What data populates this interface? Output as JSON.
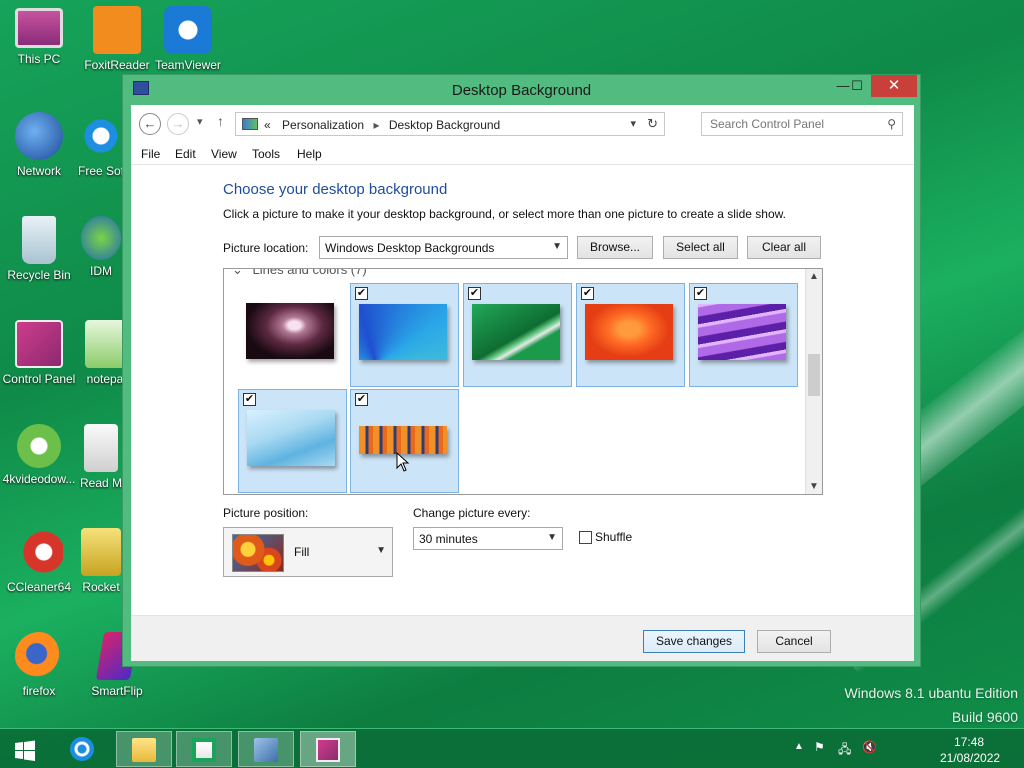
{
  "desktop": {
    "icons": [
      {
        "label": "This PC"
      },
      {
        "label": "FoxitReader"
      },
      {
        "label": "TeamViewer"
      },
      {
        "label": "Network"
      },
      {
        "label": "Free Sof"
      },
      {
        "label": "Recycle Bin"
      },
      {
        "label": "IDM"
      },
      {
        "label": "Control Panel"
      },
      {
        "label": "notepa"
      },
      {
        "label": "4kvideodow..."
      },
      {
        "label": "Read M"
      },
      {
        "label": "CCleaner64"
      },
      {
        "label": "Rocket"
      },
      {
        "label": "firefox"
      },
      {
        "label": "SmartFlip"
      }
    ],
    "watermark_line1": "Windows 8.1 ubantu Edition",
    "watermark_line2": "Build 9600"
  },
  "window": {
    "title": "Desktop Background",
    "controls": {
      "minimize": "—",
      "maximize": "☐",
      "close": "✕"
    },
    "address": {
      "breadcrumb_prefix": "«",
      "crumbs": [
        "Personalization",
        "Desktop Background"
      ],
      "separator": "▸"
    },
    "search": {
      "placeholder": "Search Control Panel"
    },
    "menu": [
      "File",
      "Edit",
      "View",
      "Tools",
      "Help"
    ],
    "heading": "Choose your desktop background",
    "subtext": "Click a picture to make it your desktop background, or select more than one picture to create a slide show.",
    "picture_location": {
      "label": "Picture location:",
      "value": "Windows Desktop Backgrounds",
      "browse": "Browse...",
      "select_all": "Select all",
      "clear_all": "Clear all"
    },
    "gallery": {
      "group_header": "Lines and colors (7)",
      "tiles": [
        {
          "name": "purple-nebula",
          "checked": false,
          "colors": [
            "#f0d7e6",
            "#6b2b46",
            "#1b0d14"
          ]
        },
        {
          "name": "blue-petals",
          "checked": true,
          "colors": [
            "#2aa8e8",
            "#1f4fd0",
            "#58d6c9"
          ]
        },
        {
          "name": "green-lines",
          "checked": true,
          "colors": [
            "#1a9a4a",
            "#0e6d32",
            "#6fd08a"
          ]
        },
        {
          "name": "orange-swirl",
          "checked": true,
          "colors": [
            "#ff7a2a",
            "#e53e14",
            "#ff9b3d"
          ]
        },
        {
          "name": "purple-waves",
          "checked": true,
          "colors": [
            "#b06ae8",
            "#5b1fa8",
            "#e2b6ff"
          ]
        },
        {
          "name": "light-blue-curve",
          "checked": true,
          "colors": [
            "#a9d9f2",
            "#5fb3e0",
            "#d9f1ff"
          ]
        },
        {
          "name": "orange-city",
          "checked": true,
          "colors": [
            "#2c3e7a",
            "#f09028",
            "#e86a1a"
          ]
        }
      ]
    },
    "picture_position": {
      "label": "Picture position:",
      "value": "Fill"
    },
    "change_picture": {
      "label": "Change picture every:",
      "value": "30 minutes"
    },
    "shuffle": {
      "label": "Shuffle",
      "checked": false
    },
    "save_label": "Save changes",
    "cancel_label": "Cancel"
  },
  "taskbar": {
    "time": "17:48",
    "date": "21/08/2022"
  },
  "colors": {
    "accent": "#52bb7f",
    "heading": "#1e4d9b",
    "selection": "#cce4f7"
  }
}
